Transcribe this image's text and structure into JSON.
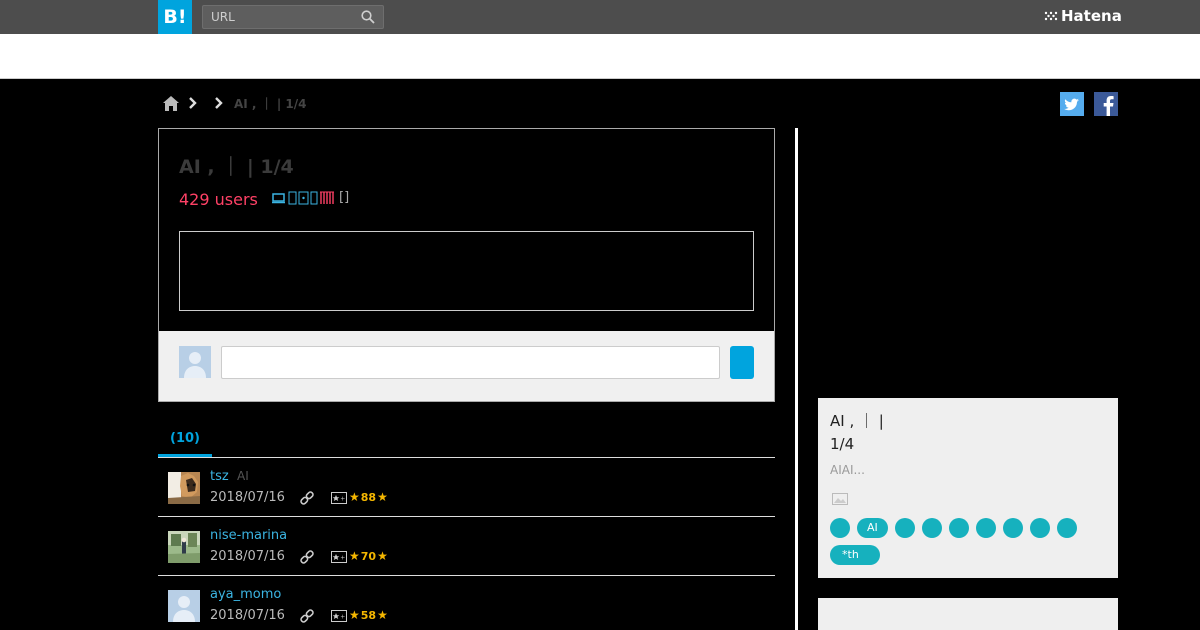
{
  "header": {
    "logo_text": "B!",
    "search_placeholder": "URL",
    "brand": "Hatena"
  },
  "breadcrumb": {
    "text": "AI , ｜ | 1/4"
  },
  "entry": {
    "title": "AI , ｜ | 1/4",
    "users": "429 users",
    "bracket": "[]"
  },
  "tabs": [
    {
      "label": "(10)"
    }
  ],
  "bookmarks": [
    {
      "user": "tsz",
      "tag": "AI",
      "date": "2018/07/16",
      "stars": "88"
    },
    {
      "user": "nise-marina",
      "tag": "",
      "date": "2018/07/16",
      "stars": "70"
    },
    {
      "user": "aya_momo",
      "tag": "",
      "date": "2018/07/16",
      "stars": "58"
    }
  ],
  "sidebar": {
    "title_line1": "AI , ｜ |",
    "title_line2": "1/4",
    "description": "AIAI...",
    "tags": [
      "",
      "AI",
      "",
      "",
      "",
      "",
      "",
      "",
      "",
      "*th"
    ]
  },
  "colors": {
    "accent": "#00a4de",
    "users_red": "#ff4166",
    "tag_teal": "#16b1be",
    "star_yellow": "#f5b700"
  }
}
